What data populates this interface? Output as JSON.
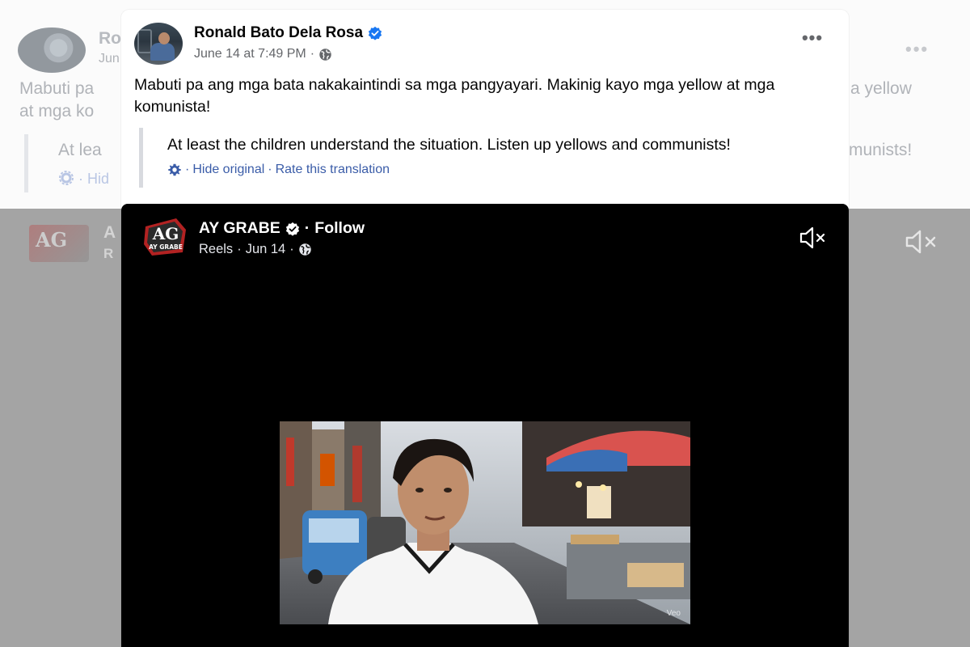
{
  "background": {
    "name_partial": "Ro",
    "date_partial": "Jun",
    "text_left_1": "Mabuti pa",
    "text_right_1": "a yellow",
    "text_left_2": "at mga ko",
    "translation_partial": "At lea",
    "translation_right": "munists!",
    "link_partial": "· Hid",
    "reel_title_partial": "A",
    "reel_meta_partial": "R",
    "logo_text": "AG"
  },
  "post": {
    "author": "Ronald Bato Dela Rosa",
    "date": "June 14 at 7:49 PM",
    "more_label": "•••",
    "text": "Mabuti pa ang mga bata nakakaintindi sa mga pangyayari. Makinig kayo mga yellow at mga komunista!",
    "translation": {
      "text": "At least the children understand the situation. Listen up yellows and communists!",
      "sep1": "·",
      "hide_original": "Hide original",
      "sep2": "·",
      "rate": "Rate this translation"
    }
  },
  "reel": {
    "page_name": "AY GRABE",
    "follow_sep": "·",
    "follow": "Follow",
    "type": "Reels",
    "sep1": "·",
    "date": "Jun 14",
    "sep2": "·",
    "logo_main": "AG",
    "logo_sub": "AY GRABE",
    "watermark": "Veo"
  },
  "colors": {
    "accent_link": "#3a5ca8",
    "verified": "#1877f2",
    "meta_gray": "#65676b"
  },
  "icons": [
    "verified-badge-icon",
    "globe-icon",
    "more-options-icon",
    "gear-icon",
    "muted-speaker-icon"
  ]
}
